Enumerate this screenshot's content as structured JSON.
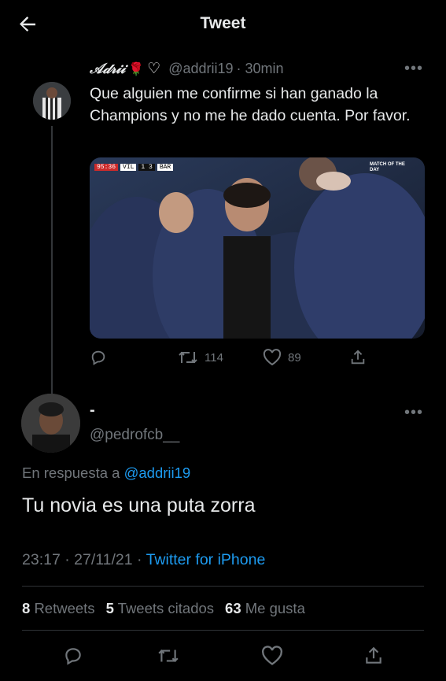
{
  "header": {
    "title": "Tweet"
  },
  "tweet1": {
    "display_name": "𝒜𝒹𝓇𝒾𝒾",
    "handle": "@addrii19",
    "time": "· 30min",
    "text": "Que alguien me confirme si han ganado la Champions y no me he dado cuenta. Por favor.",
    "media": {
      "scoreboard": {
        "clock": "95:36",
        "home": "VIL",
        "score": "1  3",
        "away": "BAR"
      },
      "watermark": "MATCH OF THE DAY"
    },
    "actions": {
      "replies": "",
      "retweets": "114",
      "likes": "89"
    }
  },
  "tweet2": {
    "display_name": "-",
    "handle": "@pedrofcb__",
    "reply_prefix": "En respuesta a",
    "reply_to": "@addrii19",
    "text": "Tu novia es una puta zorra",
    "timestamp": "23:17 · 27/11/21 ·",
    "source": "Twitter for iPhone",
    "stats": {
      "retweets_count": "8",
      "retweets_label": "Retweets",
      "quotes_count": "5",
      "quotes_label": "Tweets citados",
      "likes_count": "63",
      "likes_label": "Me gusta"
    }
  },
  "icons": [
    "back-arrow-icon",
    "heart-icon",
    "more-icon",
    "reply-icon",
    "retweet-icon",
    "like-icon",
    "share-icon",
    "rose-icon"
  ],
  "colors": {
    "background": "#000000",
    "text": "#e7e9ea",
    "muted": "#71767b",
    "accent": "#1d9bf0",
    "divider": "#2f3336"
  }
}
